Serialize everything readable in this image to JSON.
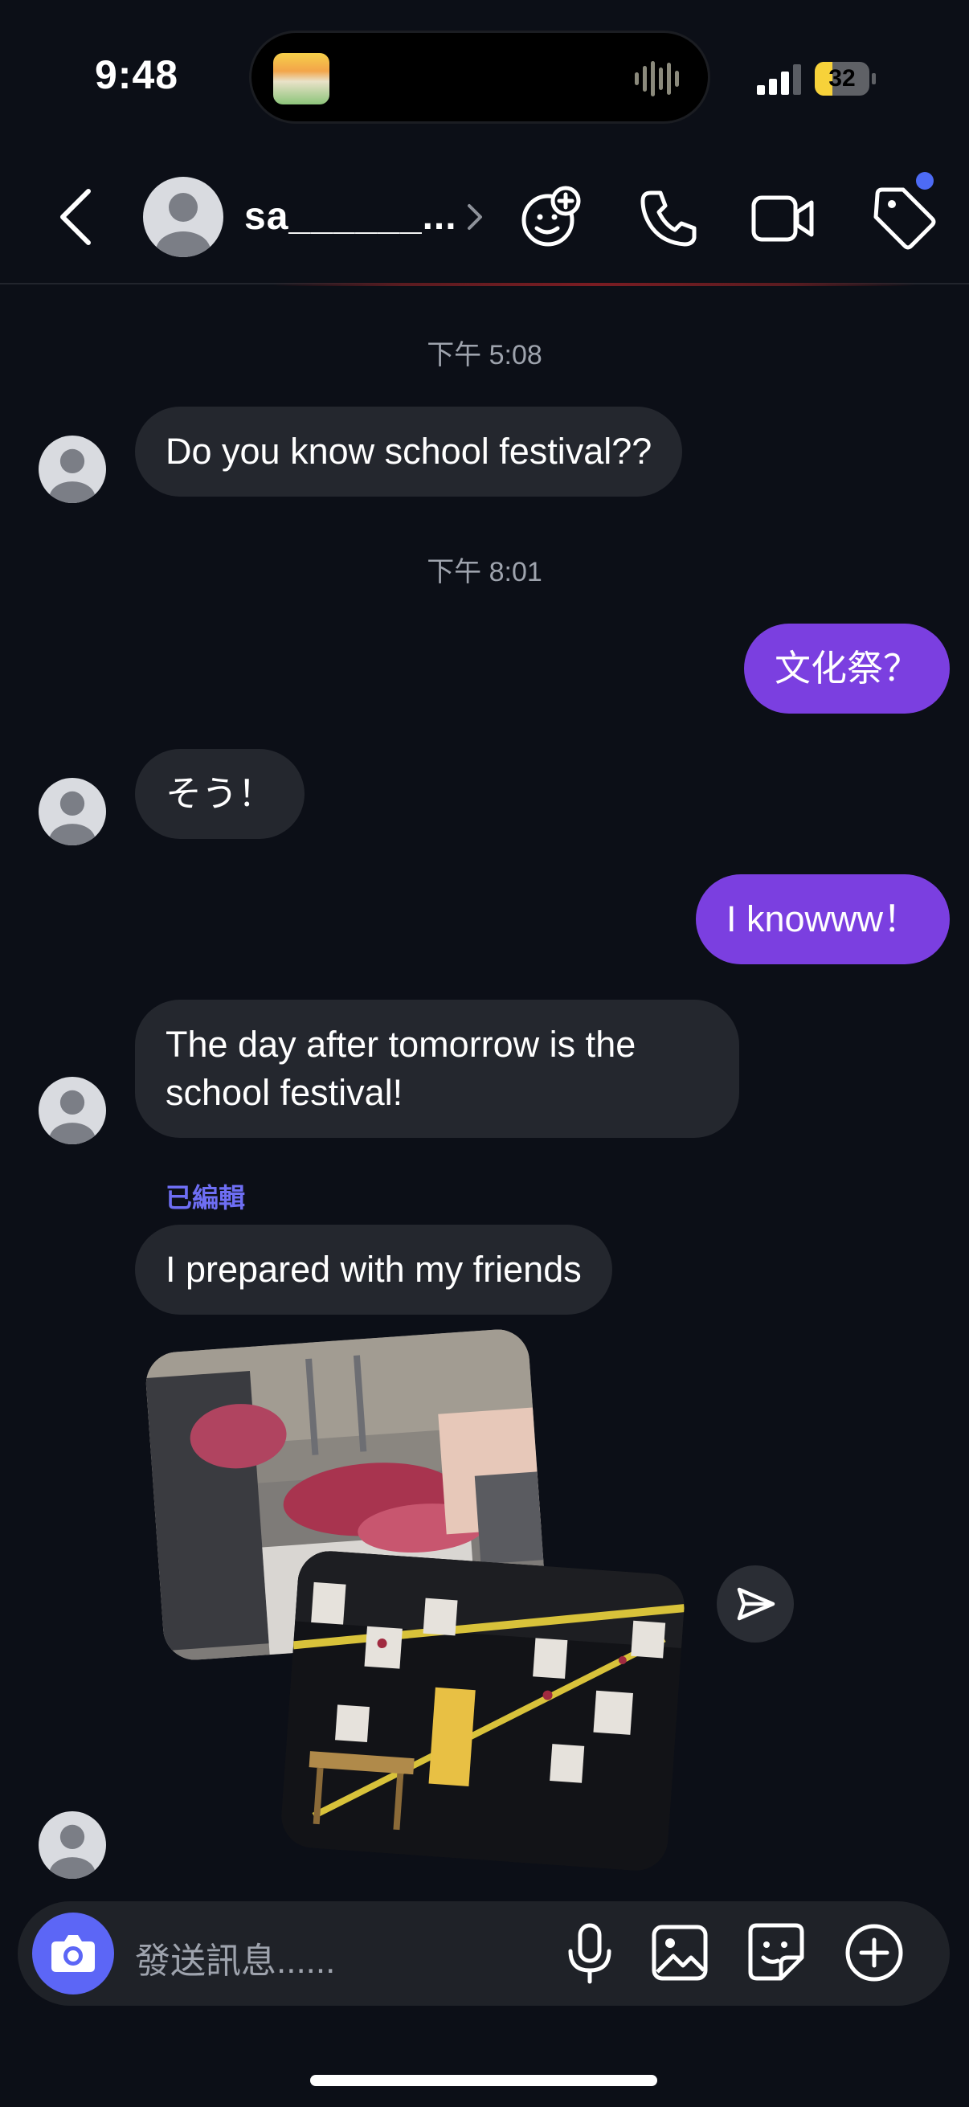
{
  "status_bar": {
    "time": "9:48",
    "battery_level": "32"
  },
  "header": {
    "contact_name": "sa______...",
    "icons": {
      "back": "chevron-left-icon",
      "effects": "add-effect-icon",
      "call": "phone-icon",
      "video": "video-camera-icon",
      "tag": "tag-icon"
    },
    "colors": {
      "notification_dot": "#4d6bf5"
    }
  },
  "conversation": {
    "timestamps": [
      "下午 5:08",
      "下午 8:01"
    ],
    "messages": [
      {
        "direction": "in",
        "text": "Do you know school festival??"
      },
      {
        "direction": "out",
        "text": "文化祭？"
      },
      {
        "direction": "in",
        "text": "そう！"
      },
      {
        "direction": "out",
        "text": "I knowww！"
      },
      {
        "direction": "in",
        "text": "The day after tomorrow is the\nschool festival!"
      },
      {
        "direction": "in",
        "text": "I prepared with my friends",
        "edited_label": "已編輯"
      }
    ],
    "photo_count": 2
  },
  "composer": {
    "placeholder": "發送訊息......",
    "icons": {
      "camera": "camera-icon",
      "mic": "microphone-icon",
      "gallery": "gallery-icon",
      "sticker": "sticker-icon",
      "more": "plus-circle-icon"
    }
  },
  "colors": {
    "background": "#0c0f17",
    "incoming_bubble": "#24272e",
    "outgoing_bubble": "#7b3fe0",
    "accent": "#5c66f6",
    "edited_label": "#6e6ef3"
  }
}
